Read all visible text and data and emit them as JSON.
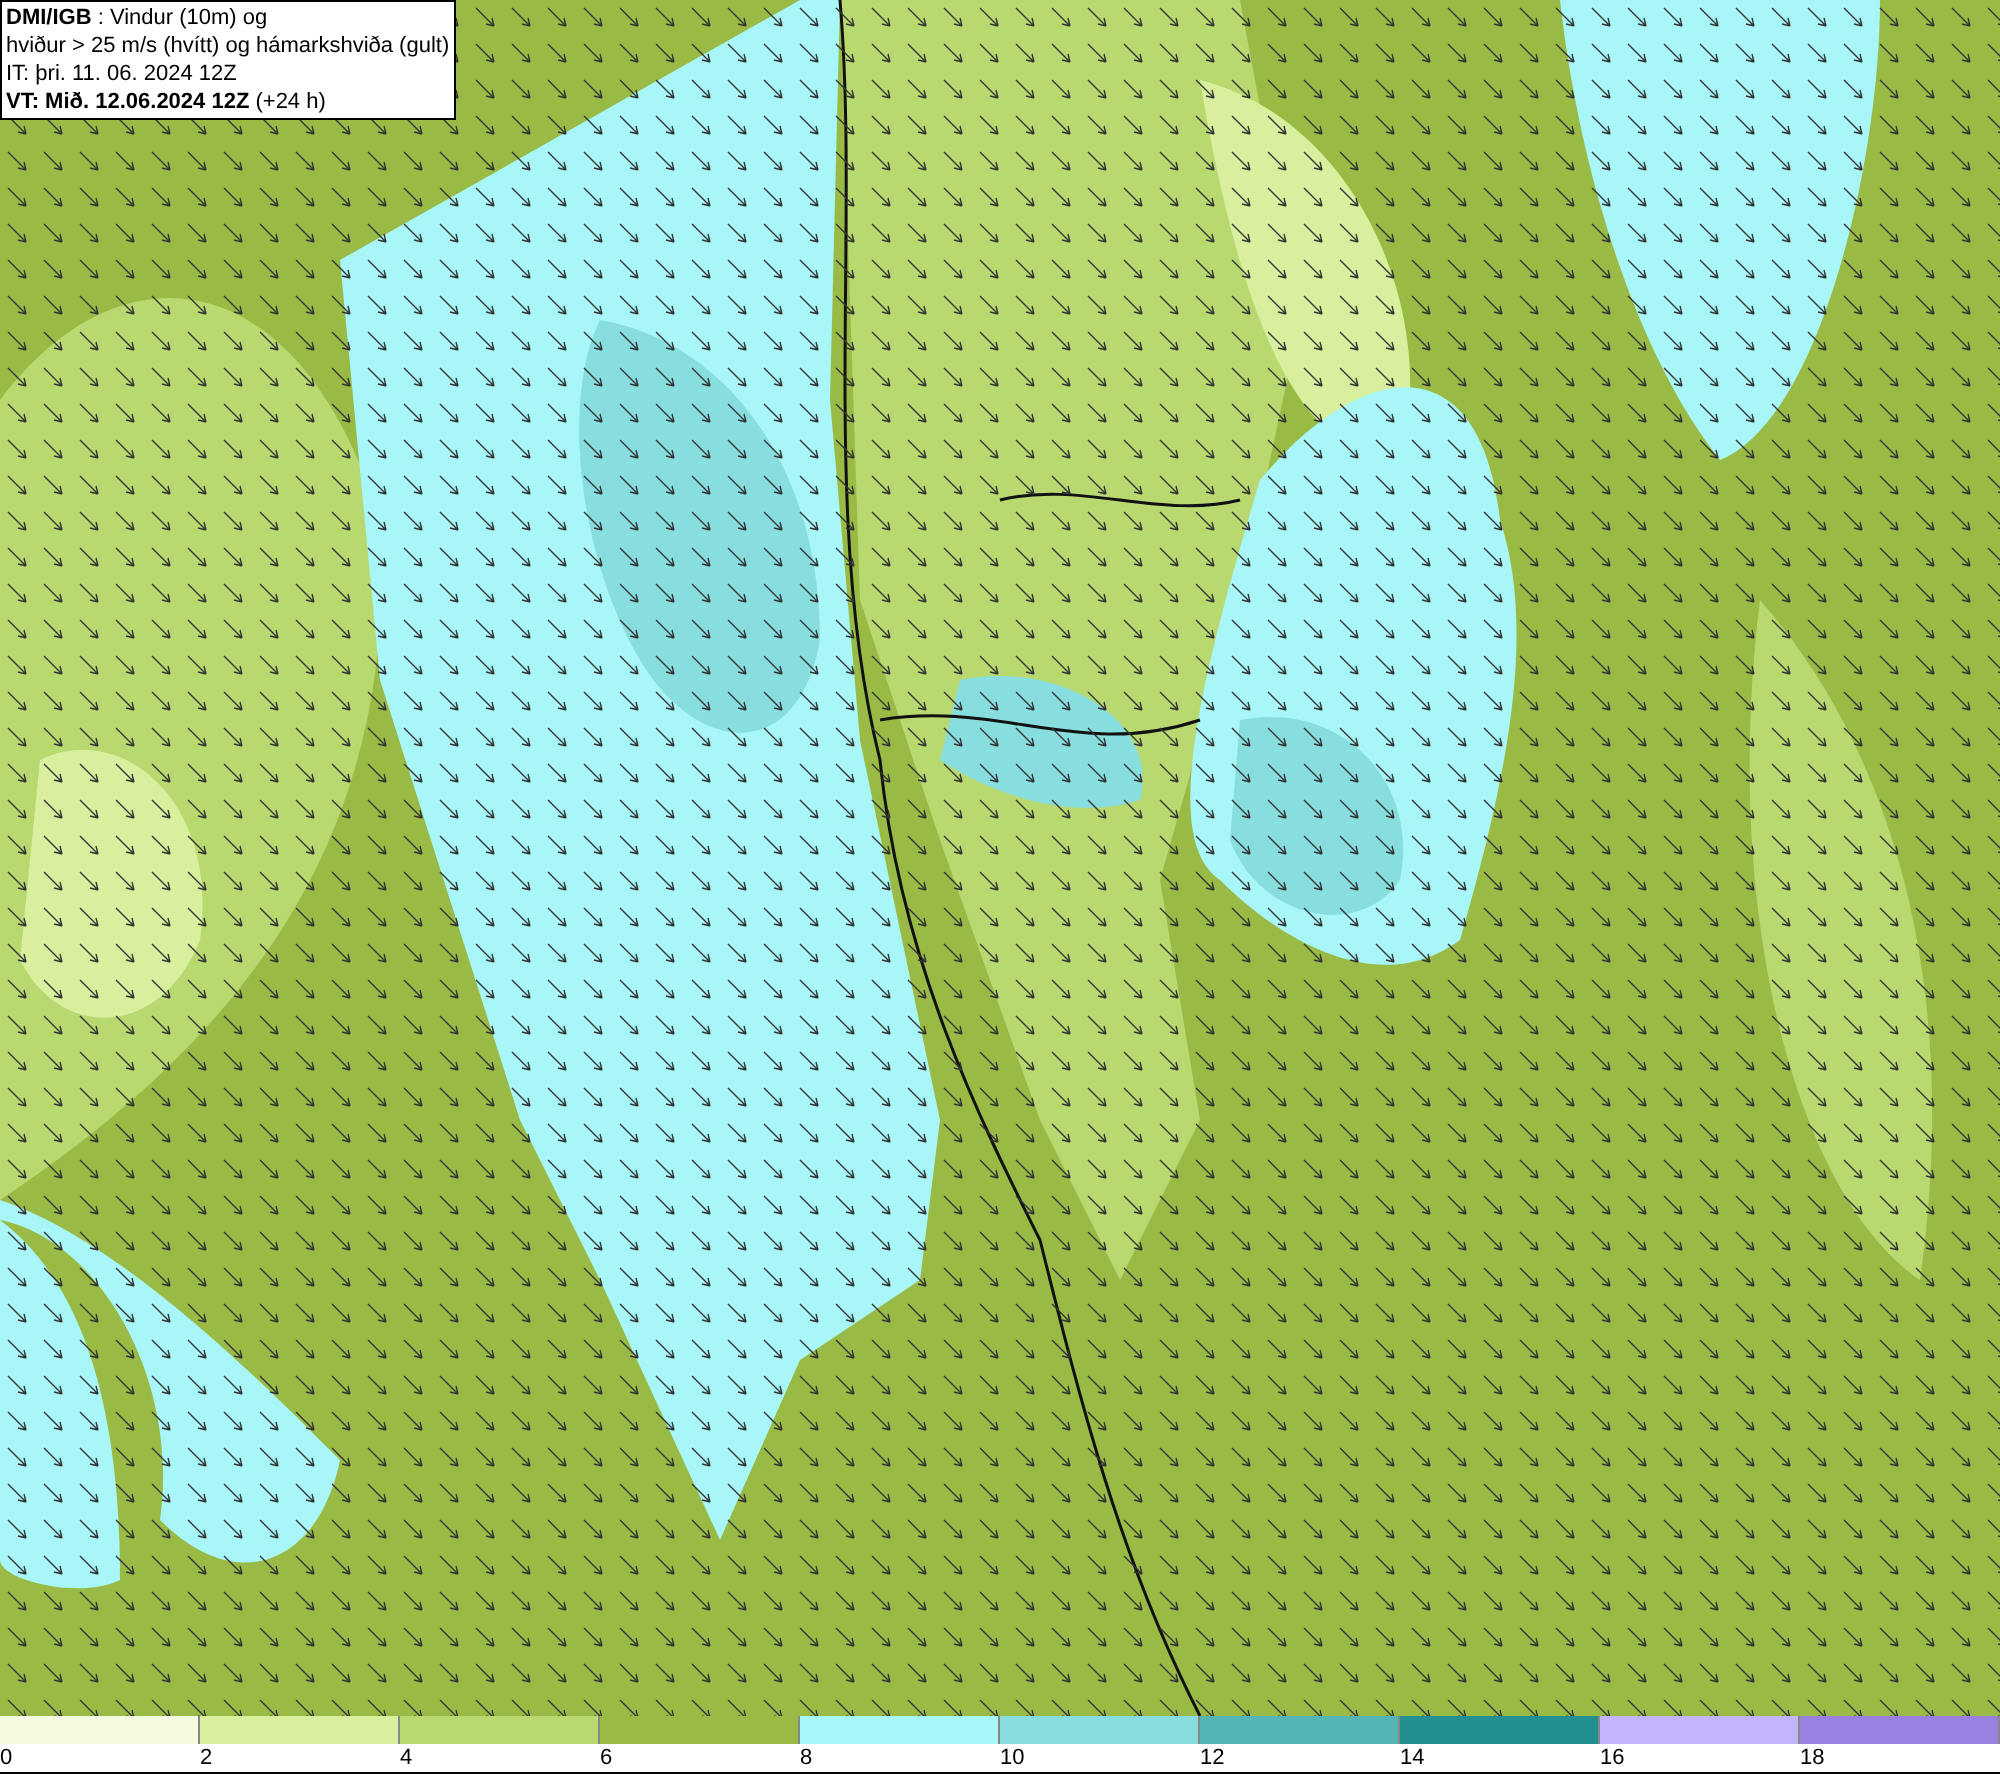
{
  "info_box": {
    "lines": [
      "**DMI/IGB** : Vindur (10m) og",
      "hviður > 25 m/s (hvítt) og hámarkshviða (gult)",
      "IT: þri. 11. 06. 2024 12Z",
      "**VT: Mið. 12.06.2024 12Z** (+24 h)"
    ]
  },
  "legend": {
    "swatches": [
      {
        "color": "#f4fbe0"
      },
      {
        "color": "#d8f09e"
      },
      {
        "color": "#b8d870"
      },
      {
        "color": "#99bb45"
      },
      {
        "color": "#a8f8fa"
      },
      {
        "color": "#88dede"
      },
      {
        "color": "#55b5b5"
      },
      {
        "color": "#229090"
      },
      {
        "color": "#c4b4fc"
      },
      {
        "color": "#9a80e0"
      }
    ],
    "labels": [
      "0",
      "2",
      "4",
      "6",
      "8",
      "10",
      "12",
      "14",
      "16",
      "18"
    ]
  }
}
